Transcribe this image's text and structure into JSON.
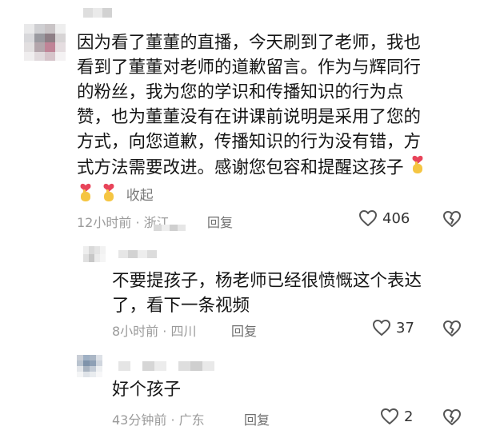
{
  "comments": [
    {
      "level": "top",
      "text_lines": [
        "因为看了董董的直播，今天刷到了老师，我也",
        "看到了董董对老师的道歉留言。作为与辉同行",
        "的粉丝，我为您的学识和传播知识的行为点",
        "赞，也为董董没有在讲课前说明是采用了您的",
        "方式，向您道歉，传播知识的行为没有错，方",
        "式方法需要改进。感谢您包容和提醒这孩子"
      ],
      "collapse_label": "收起",
      "time": "12小时前 · 浙江",
      "reply_label": "回复",
      "likes": "406",
      "emoji": "heart-hands-icon"
    },
    {
      "level": "reply",
      "text_lines": [
        "不要提孩子，杨老师已经很愤慨这个表达",
        "了，看下一条视频"
      ],
      "time": "8小时前 · 四川",
      "reply_label": "回复",
      "likes": "37"
    },
    {
      "level": "reply",
      "text_lines": [
        "好个孩子"
      ],
      "time": "43分钟前 · 广东",
      "reply_label": "回复",
      "likes": "2"
    }
  ],
  "colors": {
    "text": "#151515",
    "meta": "#9b9b9b",
    "icon": "#555555",
    "emoji_skin": "#f5c542",
    "emoji_heart": "#e8445a"
  }
}
